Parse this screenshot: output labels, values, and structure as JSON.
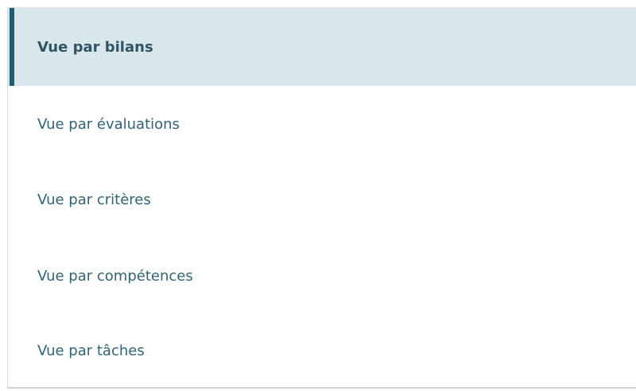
{
  "nav": {
    "items": [
      {
        "label": "Vue par bilans",
        "active": true
      },
      {
        "label": "Vue par évaluations",
        "active": false
      },
      {
        "label": "Vue par critères",
        "active": false
      },
      {
        "label": "Vue par compétences",
        "active": false
      },
      {
        "label": "Vue par tâches",
        "active": false
      }
    ]
  },
  "colors": {
    "active_background": "#d9e6eb",
    "active_indicator": "#1d5e6f",
    "item_text": "#2e6478"
  }
}
